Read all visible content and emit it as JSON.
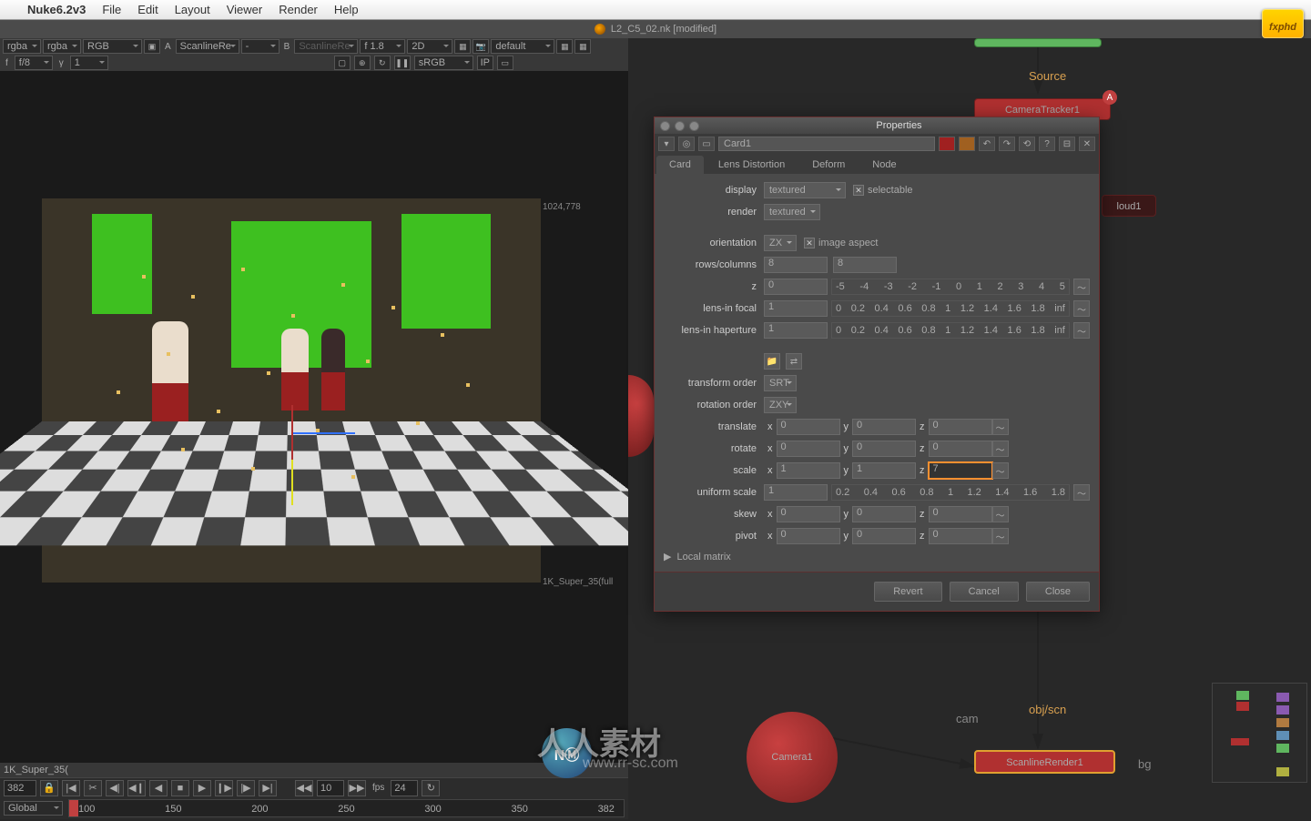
{
  "menubar": {
    "app": "Nuke6.2v3",
    "items": [
      "File",
      "Edit",
      "Layout",
      "Viewer",
      "Render",
      "Help"
    ]
  },
  "titlebar": {
    "doc": "L2_C5_02.nk [modified]"
  },
  "logo": "fxphd",
  "toolbar1": {
    "ch1": "rgba",
    "ch2": "rgba",
    "layer": "RGB",
    "A": "A",
    "srcA": "ScanlineRe",
    "dash": "-",
    "B": "B",
    "srcB": "ScanlineRe",
    "exp": "f 1.8",
    "mode": "2D",
    "proxy": "",
    "view": "default"
  },
  "toolbar2": {
    "f": "f",
    "fstop": "f/8",
    "gamma": "γ",
    "gval": "1",
    "cspace": "sRGB",
    "ip": "IP"
  },
  "viewer": {
    "coords": "1024,778",
    "format": "1K_Super_35(full",
    "formatbar": "1K_Super_35("
  },
  "timebar": {
    "frame": "382",
    "fps_lbl": "fps",
    "fps": "24",
    "rate": "10"
  },
  "global": {
    "mode": "Global",
    "ticks": [
      "100",
      "150",
      "200",
      "250",
      "300",
      "350",
      "382"
    ]
  },
  "nodes": {
    "source": "Source",
    "camtrack": "CameraTracker1",
    "cloud": "loud1",
    "camera": "Camera1",
    "scanline": "ScanlineRender1",
    "cam_lbl": "cam",
    "objscn_lbl": "obj/scn",
    "bg_lbl": "bg"
  },
  "props": {
    "title": "Properties",
    "nodename": "Card1",
    "tabs": [
      "Card",
      "Lens Distortion",
      "Deform",
      "Node"
    ],
    "display_lbl": "display",
    "display": "textured",
    "selectable": "selectable",
    "render_lbl": "render",
    "render": "textured",
    "orientation_lbl": "orientation",
    "orientation": "ZX",
    "imgaspect": "image aspect",
    "rowscols_lbl": "rows/columns",
    "rows": "8",
    "cols": "8",
    "z_lbl": "z",
    "z": "0",
    "lensfocal_lbl": "lens-in focal",
    "lensfocal": "1",
    "lenshap_lbl": "lens-in haperture",
    "lenshap": "1",
    "torder_lbl": "transform order",
    "torder": "SRT",
    "rorder_lbl": "rotation order",
    "rorder": "ZXY",
    "translate_lbl": "translate",
    "tx": "0",
    "ty": "0",
    "tz": "0",
    "rotate_lbl": "rotate",
    "rx": "0",
    "ry": "0",
    "rz": "0",
    "scale_lbl": "scale",
    "sx": "1",
    "sy": "1",
    "sz": "7",
    "uscale_lbl": "uniform scale",
    "uscale": "1",
    "skew_lbl": "skew",
    "skx": "0",
    "sky": "0",
    "skz": "0",
    "pivot_lbl": "pivot",
    "px": "0",
    "py": "0",
    "pz": "0",
    "localmatrix": "Local matrix",
    "revert": "Revert",
    "cancel": "Cancel",
    "close": "Close",
    "x": "x",
    "y": "y",
    "zl": "z"
  }
}
